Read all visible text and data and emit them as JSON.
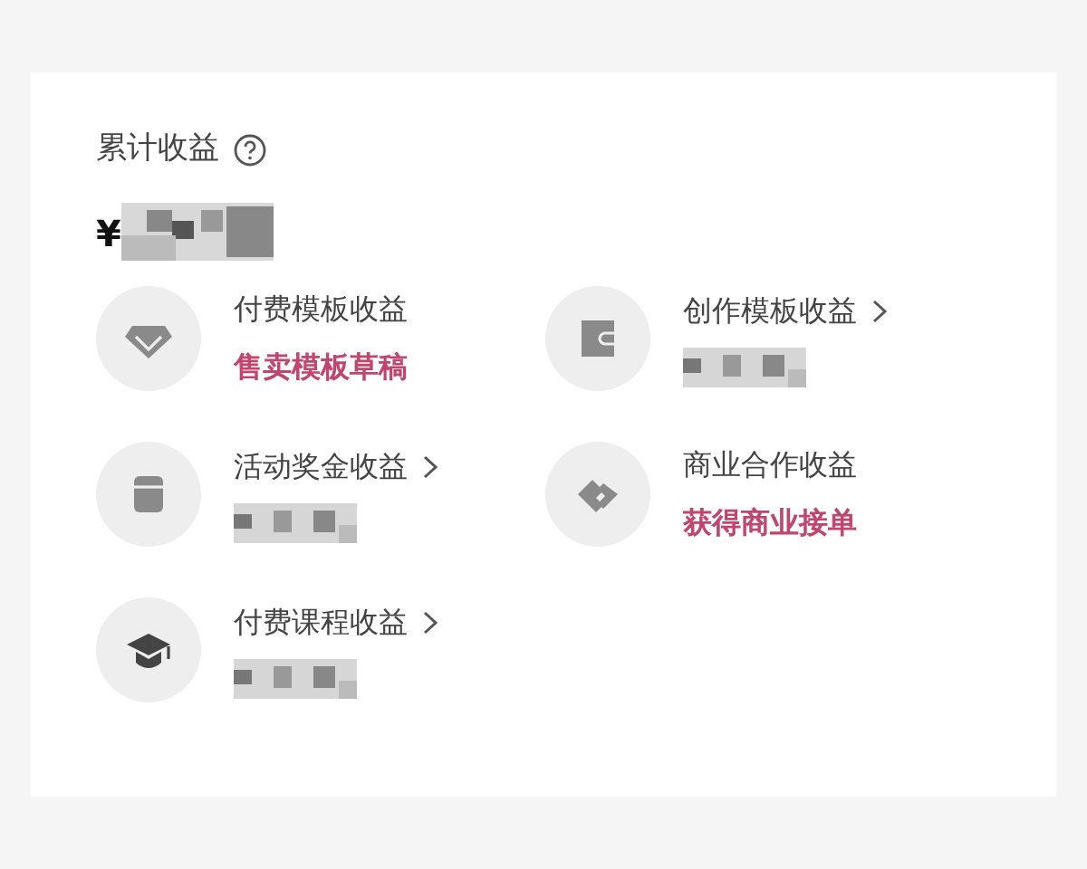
{
  "header": {
    "title": "累计收益",
    "help": true
  },
  "total": {
    "currency": "¥"
  },
  "items": [
    {
      "title": "付费模板收益",
      "chevron": false,
      "kind": "link",
      "subtitle": "售卖模板草稿"
    },
    {
      "title": "创作模板收益",
      "chevron": true,
      "kind": "value"
    },
    {
      "title": "活动奖金收益",
      "chevron": true,
      "kind": "value"
    },
    {
      "title": "商业合作收益",
      "chevron": false,
      "kind": "link",
      "subtitle": "获得商业接单"
    },
    {
      "title": "付费课程收益",
      "chevron": true,
      "kind": "value"
    }
  ]
}
